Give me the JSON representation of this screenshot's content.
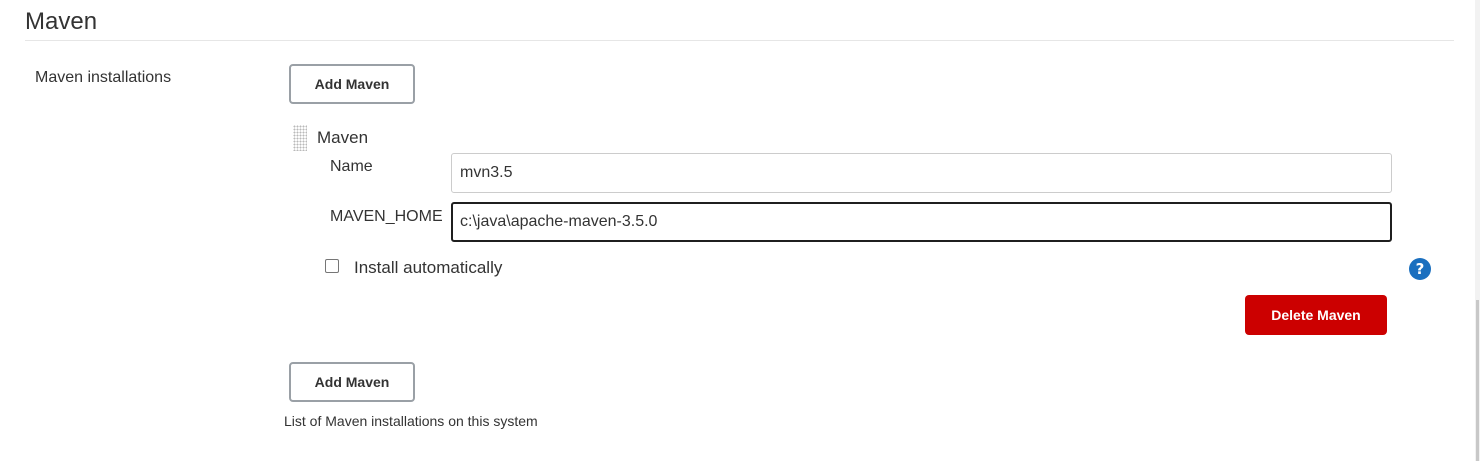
{
  "section": {
    "title": "Maven"
  },
  "maven_installations": {
    "label": "Maven installations",
    "add_button_label": "Add Maven",
    "description": "List of Maven installations on this system",
    "item": {
      "title": "Maven",
      "name_label": "Name",
      "name_value": "mvn3.5",
      "home_label": "MAVEN_HOME",
      "home_value": "c:\\java\\apache-maven-3.5.0",
      "install_automatically_label": "Install automatically",
      "install_automatically_checked": false,
      "help_icon": "question-mark-icon",
      "delete_button_label": "Delete Maven"
    }
  },
  "colors": {
    "delete_button": "#cc0000",
    "help_icon": "#1a6fbf"
  }
}
